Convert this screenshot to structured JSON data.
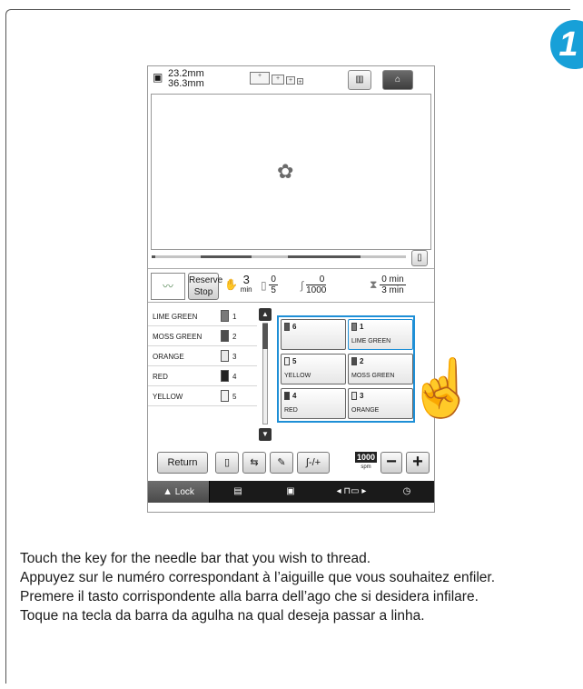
{
  "topbar": {
    "size_width": "23.2mm",
    "size_height": "36.3mm",
    "home_icon": "home-icon",
    "frame_icon": "frame-display-icon"
  },
  "preview": {
    "design_icon": "embroidery-design-icon"
  },
  "progress": {
    "value": 0.0
  },
  "info": {
    "reserve_stop_line1": "Reserve",
    "reserve_stop_line2": "Stop",
    "time_value": "3",
    "time_unit": "min",
    "color_num": "0",
    "color_den": "5",
    "stitch_num": "0",
    "stitch_den": "1000",
    "remaining_num": "0 min",
    "remaining_den": "3 min"
  },
  "color_list": [
    {
      "name": "LIME GREEN",
      "needle": "1",
      "color": "#7a7a7a",
      "current": true
    },
    {
      "name": "MOSS GREEN",
      "needle": "2",
      "color": "#4d4d4d",
      "current": false
    },
    {
      "name": "ORANGE",
      "needle": "3",
      "color": "#e8e8e8",
      "current": false
    },
    {
      "name": "RED",
      "needle": "4",
      "color": "#3a3a3a",
      "current": false
    },
    {
      "name": "YELLOW",
      "needle": "5",
      "color": "#f2f2f2",
      "current": false
    }
  ],
  "needle_keys": [
    {
      "num": "6",
      "label": "",
      "color": "#555555"
    },
    {
      "num": "1",
      "label": "LIME GREEN",
      "color": "#7a7a7a"
    },
    {
      "num": "5",
      "label": "YELLOW",
      "color": "#f2f2f2"
    },
    {
      "num": "2",
      "label": "MOSS GREEN",
      "color": "#4d4d4d"
    },
    {
      "num": "4",
      "label": "RED",
      "color": "#3a3a3a"
    },
    {
      "num": "3",
      "label": "ORANGE",
      "color": "#e8e8e8"
    }
  ],
  "bottom": {
    "return_label": "Return",
    "speed_value": "1000",
    "speed_unit": "spm",
    "minus_label": "−",
    "plus_label": "+"
  },
  "dock": {
    "lock_label": "Lock",
    "lock_icon": "warning-icon"
  },
  "accent_color": "#1e8fd6",
  "step_badge": "1",
  "caption": [
    "Touch the key for the needle bar that you wish to thread.",
    "Appuyez sur le numéro correspondant à l’aiguille que vous souhaitez enfiler.",
    "Premere il tasto corrispondente alla barra dell’ago che si desidera infilare.",
    "Toque na tecla da barra da agulha na qual deseja passar a linha."
  ]
}
